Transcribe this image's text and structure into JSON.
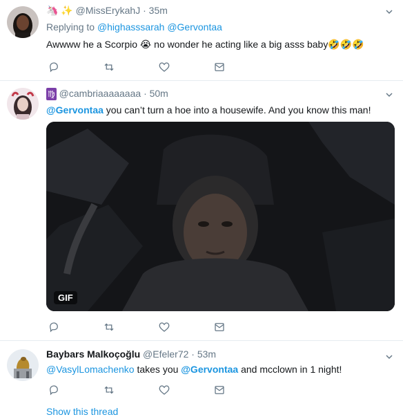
{
  "tweets": [
    {
      "header_emojis": "🦄 ✨",
      "handle": "@MissErykahJ",
      "time": "· 35m",
      "reply_prefix": "Replying to",
      "reply_to_1": "@highasssarah",
      "reply_to_2": "@Gervontaa",
      "text": "Awwww he a Scorpio 😭 no wonder he acting like a big asss baby🤣🤣🤣"
    },
    {
      "header_emojis": "♍",
      "handle": "@cambriaaaaaaaa",
      "time": "· 50m",
      "mention": "@Gervontaa",
      "text": " you can’t turn a hoe into a housewife. And you know this man!",
      "gif_label": "GIF"
    },
    {
      "name": "Baybars Malkoçoğlu",
      "handle": "@Efeler72",
      "time": "· 53m",
      "mention_1": "@VasylLomachenko",
      "text_1": " takes you ",
      "mention_2": "@Gervontaa",
      "text_2": " and mcclown in 1 night!"
    }
  ],
  "show_thread": "Show this thread",
  "colors": {
    "link": "#1b95e0",
    "muted": "#657786",
    "divider": "#e6ecf0"
  },
  "icons": [
    "reply-icon",
    "retweet-icon",
    "like-icon",
    "dm-icon",
    "chevron-down-icon"
  ]
}
